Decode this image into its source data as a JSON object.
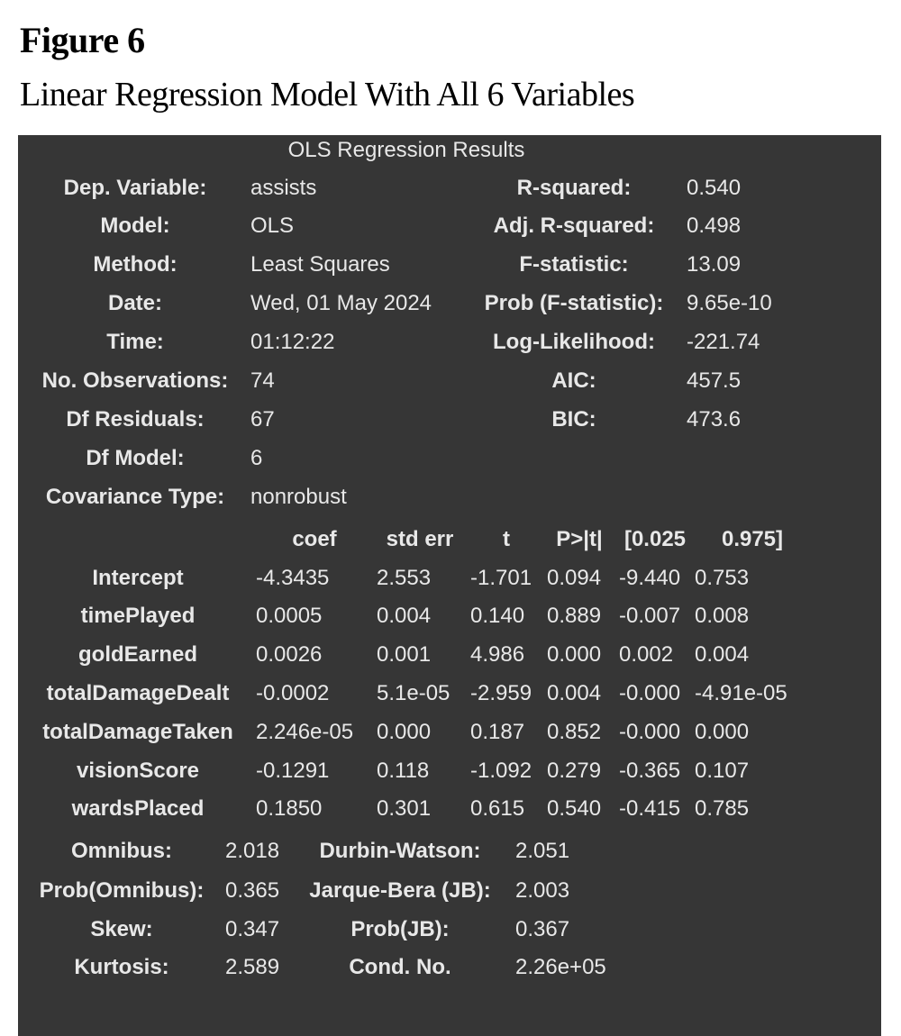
{
  "figure": {
    "label": "Figure 6",
    "caption": "Linear Regression Model With All 6 Variables"
  },
  "results": {
    "title": "OLS Regression Results",
    "summary_rows": [
      {
        "l1": "Dep. Variable:",
        "v1": "assists",
        "l2": "R-squared:",
        "v2": "0.540"
      },
      {
        "l1": "Model:",
        "v1": "OLS",
        "l2": "Adj. R-squared:",
        "v2": "0.498"
      },
      {
        "l1": "Method:",
        "v1": "Least Squares",
        "l2": "F-statistic:",
        "v2": "13.09"
      },
      {
        "l1": "Date:",
        "v1": "Wed, 01 May 2024",
        "l2": "Prob (F-statistic):",
        "v2": "9.65e-10"
      },
      {
        "l1": "Time:",
        "v1": "01:12:22",
        "l2": "Log-Likelihood:",
        "v2": "-221.74"
      },
      {
        "l1": "No. Observations:",
        "v1": "74",
        "l2": "AIC:",
        "v2": "457.5"
      },
      {
        "l1": "Df Residuals:",
        "v1": "67",
        "l2": "BIC:",
        "v2": "473.6"
      },
      {
        "l1": "Df Model:",
        "v1": "6",
        "l2": "",
        "v2": ""
      },
      {
        "l1": "Covariance Type:",
        "v1": "nonrobust",
        "l2": "",
        "v2": ""
      }
    ],
    "coef_headers": [
      "coef",
      "std err",
      "t",
      "P>|t|",
      "[0.025",
      "0.975]"
    ],
    "coef_rows": [
      {
        "name": "Intercept",
        "coef": "-4.3435",
        "se": "2.553",
        "t": "-1.701",
        "p": "0.094",
        "lo": "-9.440",
        "hi": "0.753"
      },
      {
        "name": "timePlayed",
        "coef": "0.0005",
        "se": "0.004",
        "t": "0.140",
        "p": "0.889",
        "lo": "-0.007",
        "hi": "0.008"
      },
      {
        "name": "goldEarned",
        "coef": "0.0026",
        "se": "0.001",
        "t": "4.986",
        "p": "0.000",
        "lo": "0.002",
        "hi": "0.004"
      },
      {
        "name": "totalDamageDealt",
        "coef": "-0.0002",
        "se": "5.1e-05",
        "t": "-2.959",
        "p": "0.004",
        "lo": "-0.000",
        "hi": "-4.91e-05"
      },
      {
        "name": "totalDamageTaken",
        "coef": "2.246e-05",
        "se": "0.000",
        "t": "0.187",
        "p": "0.852",
        "lo": "-0.000",
        "hi": "0.000"
      },
      {
        "name": "visionScore",
        "coef": "-0.1291",
        "se": "0.118",
        "t": "-1.092",
        "p": "0.279",
        "lo": "-0.365",
        "hi": "0.107"
      },
      {
        "name": "wardsPlaced",
        "coef": "0.1850",
        "se": "0.301",
        "t": "0.615",
        "p": "0.540",
        "lo": "-0.415",
        "hi": "0.785"
      }
    ],
    "diagnostic_rows": [
      {
        "l1": "Omnibus:",
        "v1": "2.018",
        "l2": "Durbin-Watson:",
        "v2": "2.051"
      },
      {
        "l1": "Prob(Omnibus):",
        "v1": "0.365",
        "l2": "Jarque-Bera (JB):",
        "v2": "2.003"
      },
      {
        "l1": "Skew:",
        "v1": "0.347",
        "l2": "Prob(JB):",
        "v2": "0.367"
      },
      {
        "l1": "Kurtosis:",
        "v1": "2.589",
        "l2": "Cond. No.",
        "v2": "2.26e+05"
      }
    ]
  }
}
